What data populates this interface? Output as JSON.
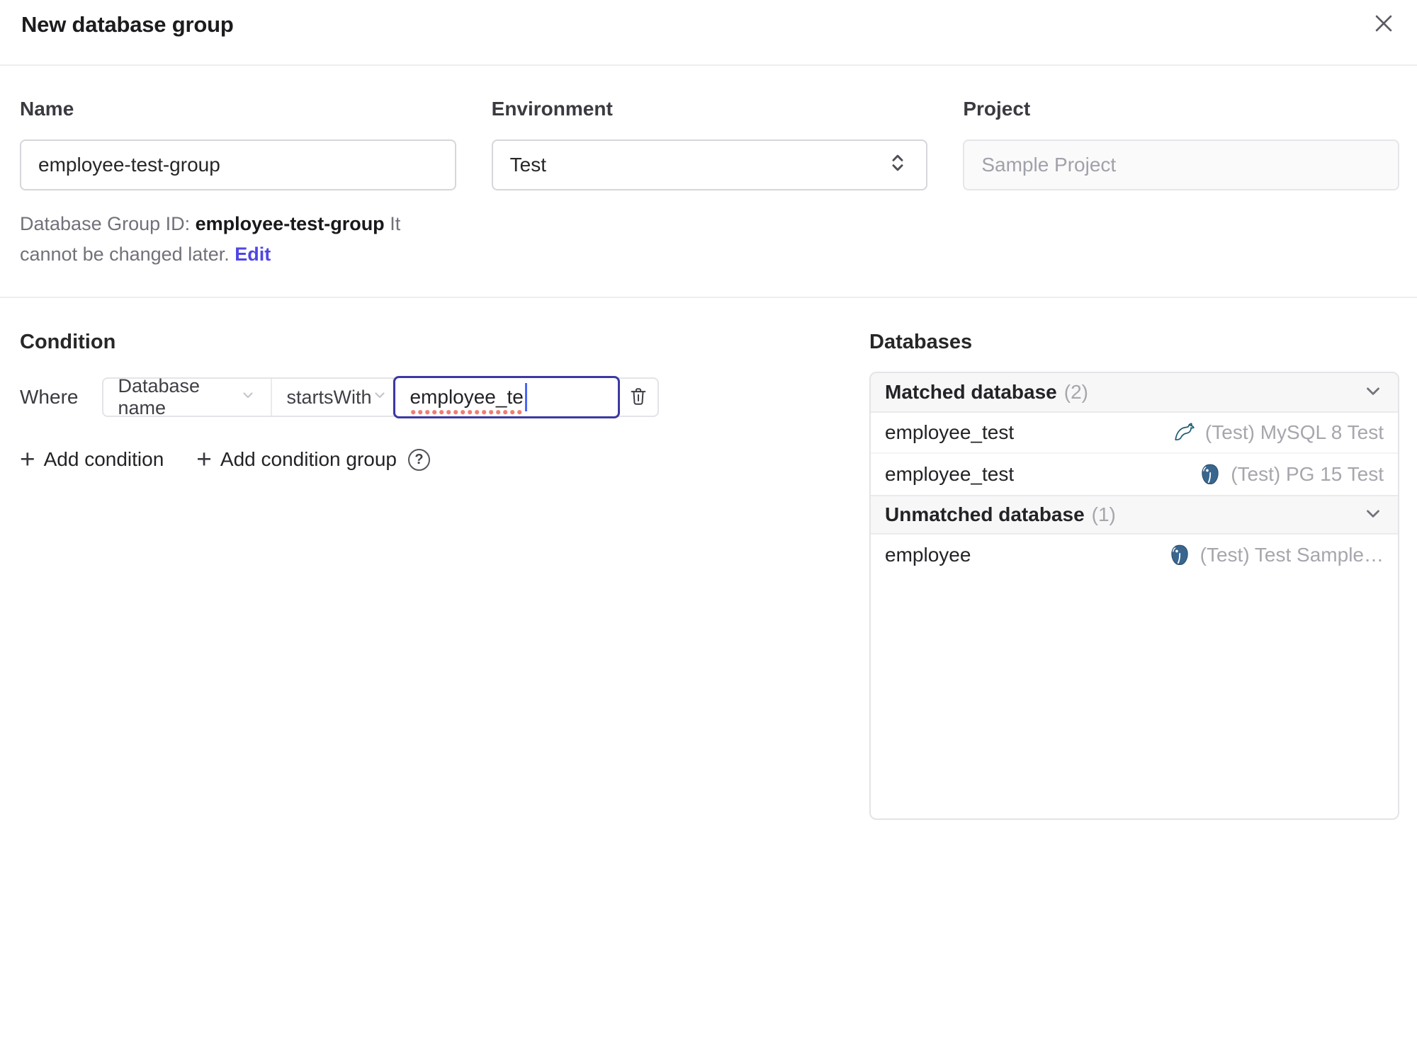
{
  "dialog": {
    "title": "New database group"
  },
  "form": {
    "name": {
      "label": "Name",
      "value": "employee-test-group"
    },
    "environment": {
      "label": "Environment",
      "value": "Test"
    },
    "project": {
      "label": "Project",
      "value": "Sample Project"
    },
    "id_hint": {
      "prefix": "Database Group ID: ",
      "id": "employee-test-group",
      "suffix": " It cannot be changed later. ",
      "edit_label": "Edit"
    }
  },
  "condition": {
    "heading": "Condition",
    "where_label": "Where",
    "factor": "Database name",
    "operator": "startsWith",
    "value": "employee_te",
    "add_condition": "Add condition",
    "add_condition_group": "Add condition group"
  },
  "databases": {
    "heading": "Databases",
    "groups": [
      {
        "title": "Matched database",
        "count": "(2)",
        "rows": [
          {
            "name": "employee_test",
            "engine": "mysql",
            "instance": "(Test) MySQL 8 Test"
          },
          {
            "name": "employee_test",
            "engine": "postgres",
            "instance": "(Test) PG 15 Test"
          }
        ]
      },
      {
        "title": "Unmatched database",
        "count": "(1)",
        "rows": [
          {
            "name": "employee",
            "engine": "postgres",
            "instance": "(Test) Test Sample…"
          }
        ]
      }
    ]
  },
  "icons": {
    "plus": "+",
    "help": "?"
  },
  "colors": {
    "accent": "#4f46e5",
    "focus_border": "#3c39a3",
    "mysql": "#1d5a73",
    "postgres": "#39668f",
    "muted_text": "#a1a1aa",
    "spellcheck_underline": "#e74c3c"
  }
}
